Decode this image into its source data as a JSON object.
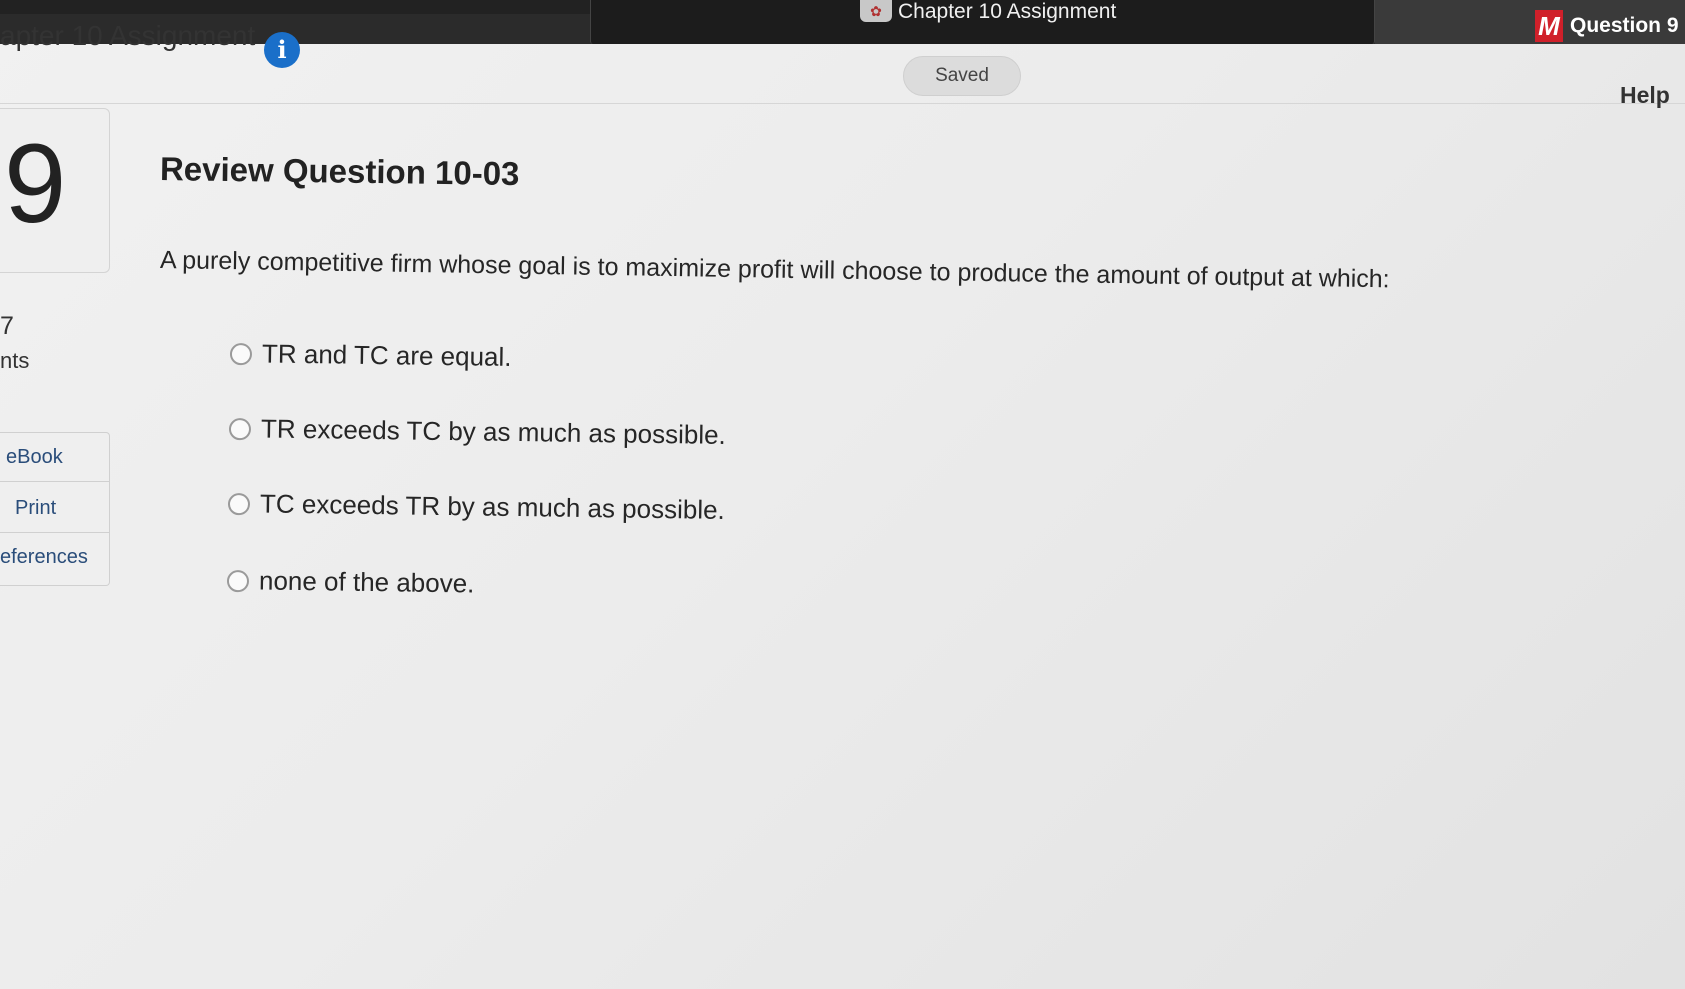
{
  "browser": {
    "active_tab_title": "Chapter 10 Assignment",
    "right_tab_logo": "M",
    "right_tab_title": "Question 9 -"
  },
  "header": {
    "assignment_title": "apter 10 Assignment",
    "info_icon": "info-icon",
    "saved_label": "Saved",
    "help_label": "Help"
  },
  "sidebar": {
    "question_number": "9",
    "points_value": "7",
    "points_label": "nts",
    "tools": [
      {
        "label": "eBook"
      },
      {
        "label": "Print"
      },
      {
        "label": "eferences"
      }
    ]
  },
  "question": {
    "title": "Review Question 10-03",
    "stem": "A purely competitive firm whose goal is to maximize profit will choose to produce the amount of output at which:",
    "options": [
      {
        "label": "TR and TC are equal."
      },
      {
        "label": "TR exceeds TC by as much as possible."
      },
      {
        "label": "TC exceeds TR by as much as possible."
      },
      {
        "label": "none of the above."
      }
    ]
  },
  "colors": {
    "info_icon_blue": "#1a6fc9",
    "brand_red": "#d0202a",
    "link_blue": "#2a4d7a"
  }
}
